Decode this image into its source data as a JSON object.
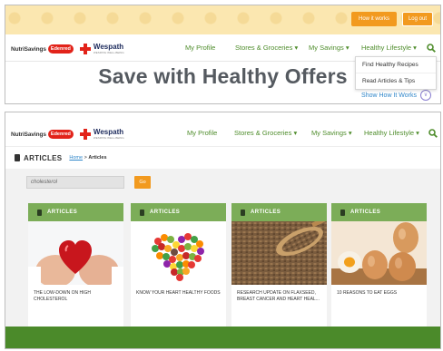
{
  "top_bar": {
    "how_it_works": "How it works",
    "log_out": "Log out"
  },
  "logo": {
    "nutrisavings": "NutriSavings",
    "edenred": "Edenred",
    "wespath": "Wespath",
    "wespath_sub": "WESPATH WELL-BEING"
  },
  "nav": {
    "items": [
      "My Profile",
      "Stores & Groceries ▾",
      "My Savings ▾",
      "Healthy Lifestyle ▾"
    ],
    "search_icon": "search-icon"
  },
  "hero": {
    "title": "Save with Healthy Offers",
    "show_how": "Show How It Works",
    "show_how_icon": "chevron-down-icon"
  },
  "dropdown": {
    "items": [
      "Find Healthy Recipes",
      "Read Articles & Tips"
    ]
  },
  "articles_page": {
    "title": "ARTICLES",
    "breadcrumb_home": "Home",
    "breadcrumb_sep": " > ",
    "breadcrumb_current": "Articles",
    "search_value": "cholesterol",
    "go_label": "Go"
  },
  "cards": [
    {
      "header": "ARTICLES",
      "title": "THE LOW-DOWN ON HIGH CHOLESTEROL"
    },
    {
      "header": "ARTICLES",
      "title": "KNOW YOUR HEART HEALTHY FOODS"
    },
    {
      "header": "ARTICLES",
      "title": "RESEARCH UPDATE ON FLAXSEED, BREAST CANCER AND HEART HEAL..."
    },
    {
      "header": "ARTICLES",
      "title": "10 REASONS TO EAT EGGS"
    }
  ],
  "colors": {
    "accent_orange": "#f29a1f",
    "nav_green": "#4f8d2c",
    "card_header_green": "#7cad58",
    "footer_green": "#4b8a2a",
    "edenred_red": "#e2231a"
  }
}
